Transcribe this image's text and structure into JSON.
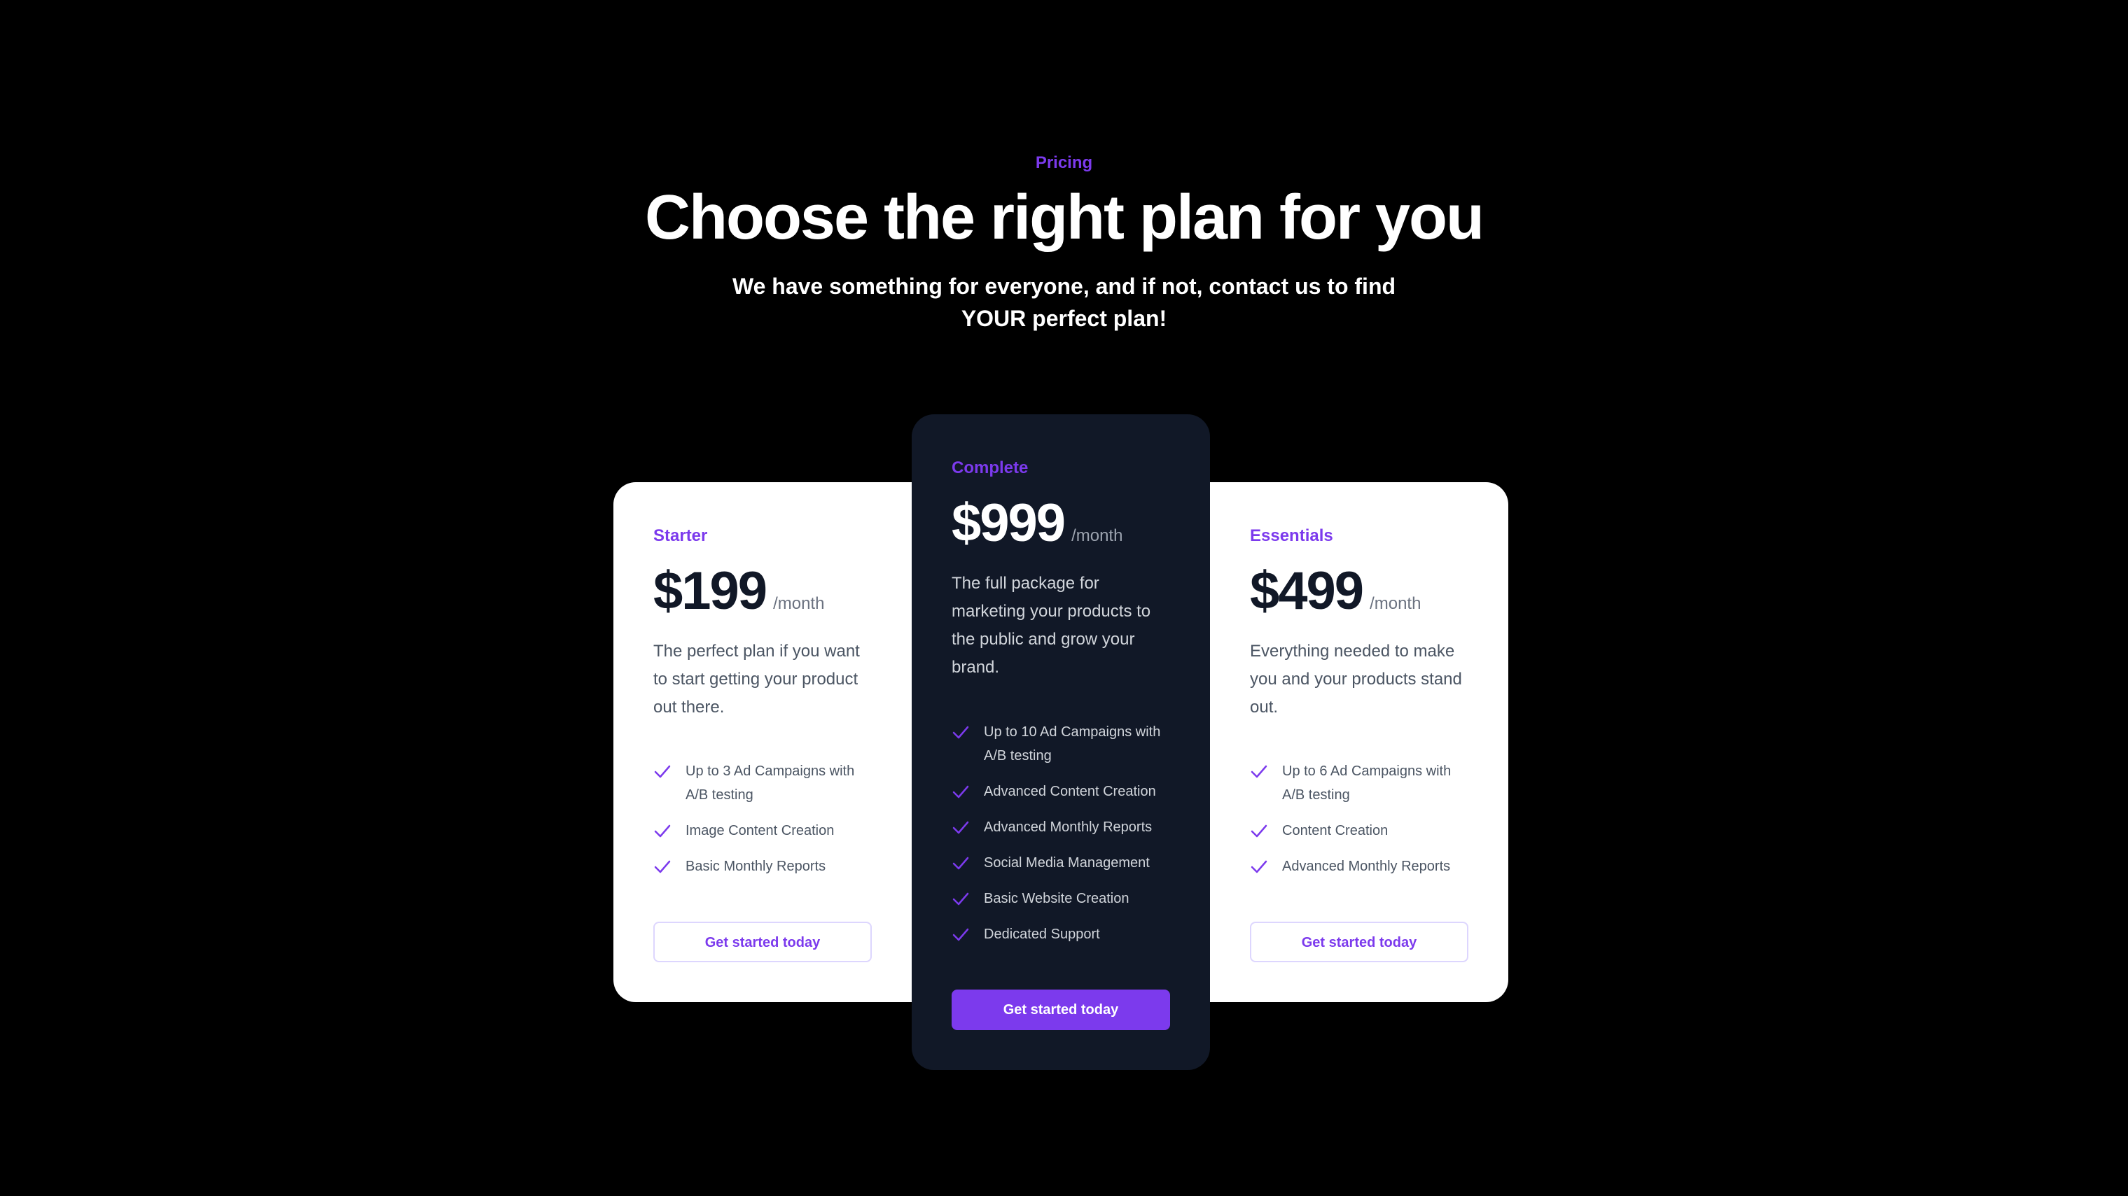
{
  "header": {
    "eyebrow": "Pricing",
    "title": "Choose the right plan for you",
    "subtitle": "We have something for everyone, and if not, contact us to find YOUR perfect plan!"
  },
  "colors": {
    "accent": "#7c3aed",
    "background": "#000000",
    "featured_card": "#111827",
    "card": "#ffffff"
  },
  "icons": {
    "feature": "check-icon"
  },
  "plans": [
    {
      "name": "Starter",
      "price": "$199",
      "period": "/month",
      "description": "The perfect plan if you want to start getting your product out there.",
      "features": [
        "Up to 3 Ad Campaigns with A/B testing",
        "Image Content Creation",
        "Basic Monthly Reports"
      ],
      "cta": "Get started today",
      "featured": false
    },
    {
      "name": "Complete",
      "price": "$999",
      "period": "/month",
      "description": "The full package for marketing your products to the public and grow your brand.",
      "features": [
        "Up to 10 Ad Campaigns with A/B testing",
        "Advanced Content Creation",
        "Advanced Monthly Reports",
        "Social Media Management",
        "Basic Website Creation",
        "Dedicated Support"
      ],
      "cta": "Get started today",
      "featured": true
    },
    {
      "name": "Essentials",
      "price": "$499",
      "period": "/month",
      "description": "Everything needed to make you and your products stand out.",
      "features": [
        "Up to 6 Ad Campaigns with A/B testing",
        "Content Creation",
        "Advanced Monthly Reports"
      ],
      "cta": "Get started today",
      "featured": false
    }
  ]
}
